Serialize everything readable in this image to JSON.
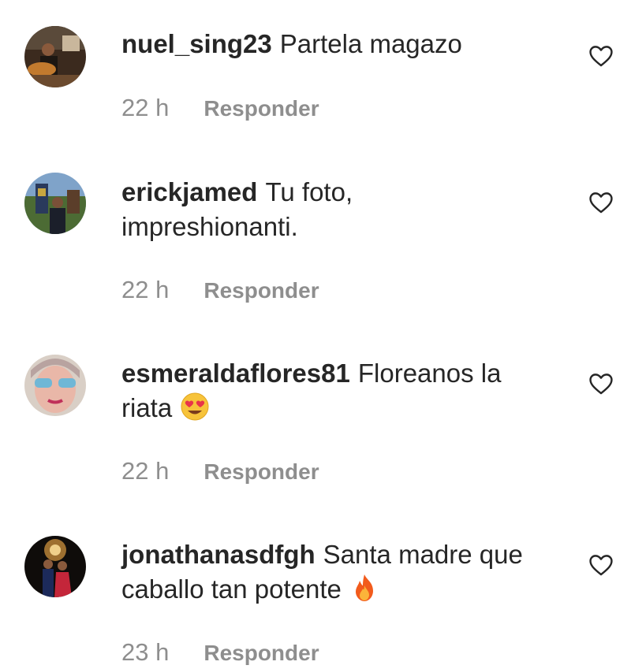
{
  "comments": [
    {
      "username": "nuel_sing23",
      "line1": "Partela magazo",
      "line2": "",
      "time": "22 h",
      "reply_label": "Responder",
      "emoji": ""
    },
    {
      "username": "erickjamed",
      "line1": "Tu foto,",
      "line2": "impreshionanti.",
      "time": "22 h",
      "reply_label": "Responder",
      "emoji": ""
    },
    {
      "username": "esmeraldaflores81",
      "line1": "Floreanos la",
      "line2": "riata",
      "time": "22 h",
      "reply_label": "Responder",
      "emoji": "heart-eyes-emoji"
    },
    {
      "username": "jonathanasdfgh",
      "line1": "Santa madre que",
      "line2": "caballo tan potente",
      "time": "23 h",
      "reply_label": "Responder",
      "emoji": "fire-emoji"
    }
  ],
  "icons": {
    "like": "heart-outline-icon"
  },
  "colors": {
    "text": "#262626",
    "secondary": "#8e8e8e"
  }
}
